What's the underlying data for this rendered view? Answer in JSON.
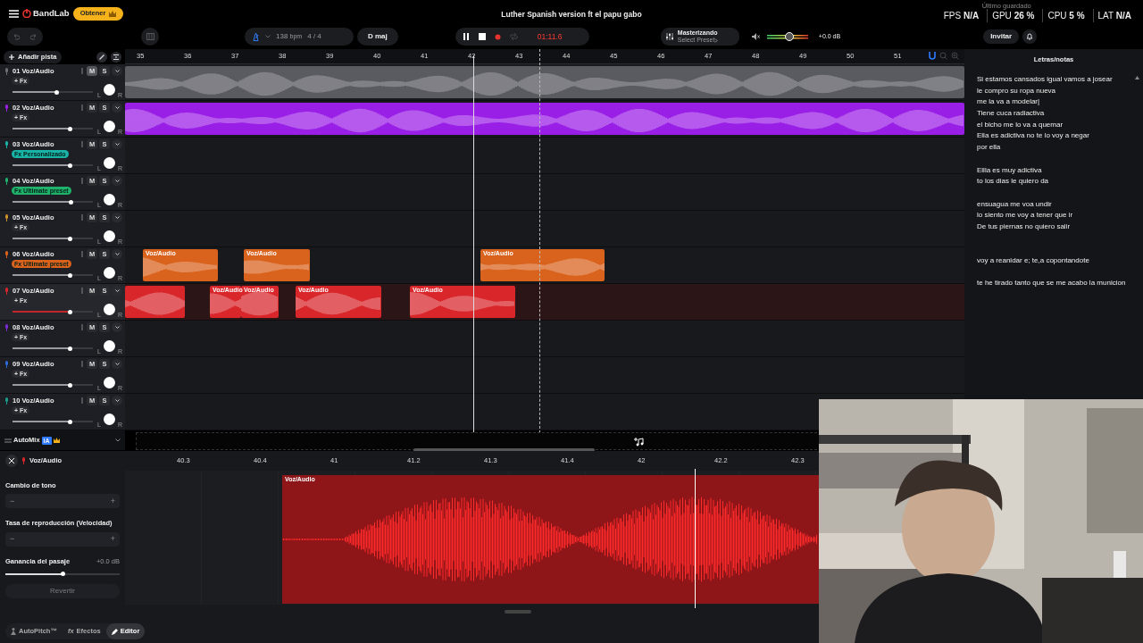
{
  "app": {
    "logo": "BandLab",
    "upgrade": "Obtener"
  },
  "title": "Luther Spanish version ft el papu gabo",
  "save_status": "Último guardado",
  "stats": [
    {
      "label": "FPS",
      "value": "N/A"
    },
    {
      "label": "GPU",
      "value": "26 %"
    },
    {
      "label": "CPU",
      "value": "5 %"
    },
    {
      "label": "LAT",
      "value": "N/A"
    }
  ],
  "toolbar": {
    "tempo": "138",
    "tempo_unit": "bpm",
    "time_signature": "4 / 4",
    "key": "D maj"
  },
  "transport": {
    "playing": true,
    "recording": true,
    "time": "01:11.6"
  },
  "mastering": {
    "title": "Masterizando",
    "preset": "Select Preset"
  },
  "master_volume": {
    "level": 0.55,
    "reading": "+0.0 dB"
  },
  "invite": "Invitar",
  "add_track": "Añadir pista",
  "ruler": [
    "35",
    "36",
    "37",
    "38",
    "39",
    "40",
    "41",
    "42",
    "43",
    "44",
    "45",
    "46",
    "47",
    "48",
    "49",
    "50",
    "51"
  ],
  "tracks": [
    {
      "number": "01",
      "name": "Voz/Audio",
      "color": "#6e6e72",
      "fx": {
        "kind": "add",
        "label": "+ Fx"
      },
      "mute": "M",
      "solo": "S",
      "muted": true,
      "level": 0.55,
      "selected": false,
      "pan": {
        "left": "L",
        "right": "R"
      },
      "clips": [
        {
          "kind": "unlabeled"
        }
      ]
    },
    {
      "number": "02",
      "name": "Voz/Audio",
      "color": "#9a1fe6",
      "fx": {
        "kind": "add",
        "label": "+ Fx"
      },
      "mute": "M",
      "solo": "S",
      "muted": false,
      "level": 0.72,
      "selected": false,
      "pan": {
        "left": "L",
        "right": "R"
      },
      "clips": [
        {
          "kind": "unlabeled"
        }
      ]
    },
    {
      "number": "03",
      "name": "Voz/Audio",
      "color": "#19b3a8",
      "fx": {
        "kind": "preset",
        "label": "Fx Personalizado"
      },
      "mute": "M",
      "solo": "S",
      "muted": false,
      "level": 0.72,
      "selected": false,
      "pan": {
        "left": "L",
        "right": "R"
      }
    },
    {
      "number": "04",
      "name": "Voz/Audio",
      "color": "#20b26a",
      "fx": {
        "kind": "preset",
        "label": "Fx Ultimate preset"
      },
      "mute": "M",
      "solo": "S",
      "muted": false,
      "level": 0.73,
      "selected": false,
      "pan": {
        "left": "L",
        "right": "R"
      }
    },
    {
      "number": "05",
      "name": "Voz/Audio",
      "color": "#c98f2b",
      "fx": {
        "kind": "add",
        "label": "+ Fx"
      },
      "mute": "M",
      "solo": "S",
      "muted": false,
      "level": 0.72,
      "selected": false,
      "pan": {
        "left": "L",
        "right": "R"
      }
    },
    {
      "number": "06",
      "name": "Voz/Audio",
      "color": "#d9621c",
      "fx": {
        "kind": "preset",
        "label": "Fx Ultimate preset"
      },
      "mute": "M",
      "solo": "S",
      "muted": false,
      "level": 0.72,
      "selected": false,
      "pan": {
        "left": "L",
        "right": "R"
      },
      "clips": [
        {
          "kind": "labeled",
          "label": "Voz/Audio"
        },
        {
          "kind": "labeled",
          "label": "Voz/Audio"
        },
        {
          "kind": "labeled",
          "label": "Voz/Audio"
        }
      ]
    },
    {
      "number": "07",
      "name": "Voz/Audio",
      "color": "#d8262b",
      "fx": {
        "kind": "add",
        "label": "+ Fx"
      },
      "mute": "M",
      "solo": "S",
      "muted": false,
      "level": 0.72,
      "selected": true,
      "pan": {
        "left": "L",
        "right": "R"
      },
      "clips": [
        {
          "kind": "unlabeled"
        },
        {
          "kind": "labeled",
          "label": "Voz/Audio"
        },
        {
          "kind": "labeled",
          "label": "Voz/Audio"
        },
        {
          "kind": "labeled",
          "label": "Voz/Audio"
        },
        {
          "kind": "labeled",
          "label": "Voz/Audio"
        }
      ]
    },
    {
      "number": "08",
      "name": "Voz/Audio",
      "color": "#7b2bd2",
      "fx": {
        "kind": "add",
        "label": "+ Fx"
      },
      "mute": "M",
      "solo": "S",
      "muted": false,
      "level": 0.72,
      "selected": false,
      "pan": {
        "left": "L",
        "right": "R"
      }
    },
    {
      "number": "09",
      "name": "Voz/Audio",
      "color": "#2b6ad2",
      "fx": {
        "kind": "add",
        "label": "+ Fx"
      },
      "mute": "M",
      "solo": "S",
      "muted": false,
      "level": 0.72,
      "selected": false,
      "pan": {
        "left": "L",
        "right": "R"
      }
    },
    {
      "number": "10",
      "name": "Voz/Audio",
      "color": "#1a9a88",
      "fx": {
        "kind": "add",
        "label": "+ Fx"
      },
      "mute": "M",
      "solo": "S",
      "muted": false,
      "level": 0.72,
      "selected": false,
      "pan": {
        "left": "L",
        "right": "R"
      }
    }
  ],
  "automix": {
    "label": "AutoMix",
    "badge": "IA"
  },
  "lyrics": {
    "title": "Letras/notas",
    "stanzas": [
      {
        "kind": "normal",
        "lines": [
          "Si estamos cansados igual vamos a josear",
          "le compro su ropa nueva",
          "me la va a modelar|",
          "Tiene cuca radiactiva",
          "el bicho me lo va a quemar",
          "Ella es adictiva no te lo voy a negar",
          "por ella"
        ]
      },
      {
        "kind": "normal",
        "lines": [
          "Ellla es muy adictiva",
          "to los dias le quiero da"
        ]
      },
      {
        "kind": "normal",
        "lines": [
          "ensuagua me voa undir",
          "lo siento me voy a tener que ir",
          "De tus piernas no quiero salir"
        ]
      },
      {
        "kind": "wide",
        "lines": [
          "voy a reanidar e; te,a copontandote"
        ]
      },
      {
        "kind": "normal",
        "lines": [
          "te he tirado tanto que se me acabo la municion"
        ]
      }
    ]
  },
  "editor": {
    "track_name": "Voz/Audio",
    "fields": [
      {
        "kind": "stepper",
        "label": "Cambio de tono",
        "minus": "−",
        "plus": "+"
      },
      {
        "kind": "stepper",
        "label": "Tasa de reproducción (Velocidad)",
        "minus": "−",
        "plus": "+"
      },
      {
        "kind": "slider",
        "label": "Ganancia del pasaje",
        "reading": "+0.0 dB",
        "level": 0.5
      }
    ],
    "reset": {
      "label": "Revertir",
      "disabled": true
    },
    "ruler": [
      "40.3",
      "40.4",
      "41",
      "41.2",
      "41.3",
      "41.4",
      "42",
      "42.2",
      "42.3"
    ],
    "clip_label": "Voz/Audio"
  },
  "bottom_tabs": [
    {
      "kind": "autopitch",
      "label": "AutoPitch™",
      "selected": false
    },
    {
      "kind": "effects",
      "icon_text": "fx",
      "label": "Efectos",
      "selected": false
    },
    {
      "kind": "editor",
      "label": "Editor",
      "selected": true
    }
  ]
}
